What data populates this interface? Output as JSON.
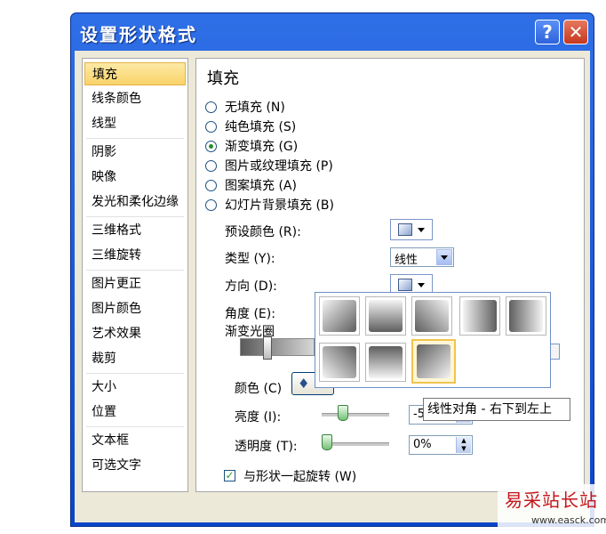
{
  "window": {
    "title": "设置形状格式",
    "help_glyph": "?",
    "close_glyph": "✕"
  },
  "sidebar": {
    "items": [
      {
        "label": "填充",
        "selected": true
      },
      {
        "label": "线条颜色"
      },
      {
        "label": "线型"
      },
      {
        "label": "阴影"
      },
      {
        "label": "映像"
      },
      {
        "label": "发光和柔化边缘"
      },
      {
        "label": "三维格式"
      },
      {
        "label": "三维旋转"
      },
      {
        "label": "图片更正"
      },
      {
        "label": "图片颜色"
      },
      {
        "label": "艺术效果"
      },
      {
        "label": "裁剪"
      },
      {
        "label": "大小"
      },
      {
        "label": "位置"
      },
      {
        "label": "文本框"
      },
      {
        "label": "可选文字"
      }
    ]
  },
  "panel": {
    "heading": "填充",
    "fill_options": [
      {
        "label": "无填充 (N)",
        "checked": false
      },
      {
        "label": "纯色填充 (S)",
        "checked": false
      },
      {
        "label": "渐变填充 (G)",
        "checked": true
      },
      {
        "label": "图片或纹理填充 (P)",
        "checked": false
      },
      {
        "label": "图案填充 (A)",
        "checked": false
      },
      {
        "label": "幻灯片背景填充 (B)",
        "checked": false
      }
    ],
    "preset_label": "预设颜色 (R):",
    "type_label": "类型 (Y):",
    "type_value": "线性",
    "direction_label": "方向 (D):",
    "angle_label": "角度 (E):",
    "stops_label": "渐变光圈",
    "color_label": "颜色 (C)",
    "brightness_label": "亮度 (I):",
    "brightness_value": "-5",
    "transparency_label": "透明度 (T):",
    "transparency_value": "0%",
    "rotate_label": "与形状一起旋转 (W)",
    "rotate_checked": true
  },
  "direction_popup": {
    "cells": [
      "linear-diagonal-tl-br",
      "linear-down",
      "linear-diagonal-tr-bl",
      "linear-right",
      "linear-left",
      "linear-diagonal-bl-tr",
      "linear-up",
      "linear-diagonal-br-tl"
    ],
    "selected_index": 7,
    "tooltip": "线性对角 - 右下到左上"
  },
  "watermark": {
    "line1": "易采站长站",
    "line2": "www.easck.com"
  },
  "colors": {
    "title_blue": "#0b45c9",
    "selection_gold": "#f9d36a",
    "dialog_bg": "#ece9d8"
  }
}
